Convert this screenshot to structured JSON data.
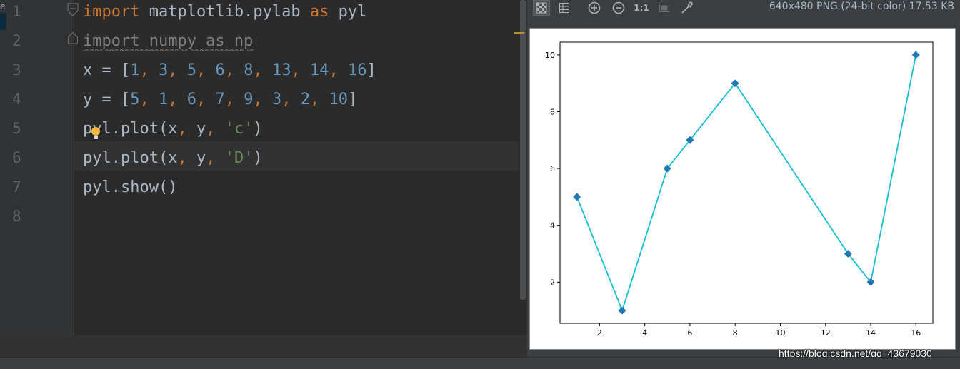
{
  "editor": {
    "side_strip_label": "e",
    "lines": [
      {
        "n": "1",
        "tokens": [
          {
            "t": "import",
            "c": "kw"
          },
          {
            "t": " matplotlib.pylab ",
            "c": ""
          },
          {
            "t": "as",
            "c": "kw"
          },
          {
            "t": " pyl",
            "c": ""
          }
        ]
      },
      {
        "n": "2",
        "tokens": [
          {
            "t": "import numpy as np",
            "c": "gray wavy"
          }
        ]
      },
      {
        "n": "3",
        "tokens": [
          {
            "t": "x = [",
            "c": ""
          },
          {
            "t": "1",
            "c": "num"
          },
          {
            "t": ", ",
            "c": "kw"
          },
          {
            "t": "3",
            "c": "num"
          },
          {
            "t": ", ",
            "c": "kw"
          },
          {
            "t": "5",
            "c": "num"
          },
          {
            "t": ", ",
            "c": "kw"
          },
          {
            "t": "6",
            "c": "num"
          },
          {
            "t": ", ",
            "c": "kw"
          },
          {
            "t": "8",
            "c": "num"
          },
          {
            "t": ", ",
            "c": "kw"
          },
          {
            "t": "13",
            "c": "num"
          },
          {
            "t": ", ",
            "c": "kw"
          },
          {
            "t": "14",
            "c": "num"
          },
          {
            "t": ", ",
            "c": "kw"
          },
          {
            "t": "16",
            "c": "num"
          },
          {
            "t": "]",
            "c": ""
          }
        ]
      },
      {
        "n": "4",
        "tokens": [
          {
            "t": "y = [",
            "c": ""
          },
          {
            "t": "5",
            "c": "num"
          },
          {
            "t": ", ",
            "c": "kw"
          },
          {
            "t": "1",
            "c": "num"
          },
          {
            "t": ", ",
            "c": "kw"
          },
          {
            "t": "6",
            "c": "num"
          },
          {
            "t": ", ",
            "c": "kw"
          },
          {
            "t": "7",
            "c": "num"
          },
          {
            "t": ", ",
            "c": "kw"
          },
          {
            "t": "9",
            "c": "num"
          },
          {
            "t": ", ",
            "c": "kw"
          },
          {
            "t": "3",
            "c": "num"
          },
          {
            "t": ", ",
            "c": "kw"
          },
          {
            "t": "2",
            "c": "num"
          },
          {
            "t": ", ",
            "c": "kw"
          },
          {
            "t": "10",
            "c": "num"
          },
          {
            "t": "]",
            "c": ""
          }
        ]
      },
      {
        "n": "5",
        "tokens": [
          {
            "t": "pyl.plot(x",
            "c": ""
          },
          {
            "t": ", ",
            "c": "kw"
          },
          {
            "t": "y",
            "c": ""
          },
          {
            "t": ", ",
            "c": "kw"
          },
          {
            "t": "'c'",
            "c": "str"
          },
          {
            "t": ")",
            "c": ""
          }
        ]
      },
      {
        "n": "6",
        "tokens": [
          {
            "t": "pyl.plot(x",
            "c": ""
          },
          {
            "t": ", ",
            "c": "kw"
          },
          {
            "t": "y",
            "c": ""
          },
          {
            "t": ", ",
            "c": "kw"
          },
          {
            "t": "'D'",
            "c": "str"
          },
          {
            "t": ")",
            "c": ""
          }
        ]
      },
      {
        "n": "7",
        "tokens": [
          {
            "t": "pyl.show()",
            "c": ""
          }
        ]
      },
      {
        "n": "8",
        "tokens": []
      }
    ]
  },
  "viewer": {
    "toolbar": {
      "chessboard": "chessboard-icon",
      "grid": "grid-icon",
      "zoom_in": "zoom-in-icon",
      "zoom_out": "zoom-out-icon",
      "actual_size_label": "1:1",
      "fit": "fit-to-window-icon",
      "picker": "color-picker-icon"
    },
    "image_info": "640x480 PNG (24-bit color) 17.53 KB"
  },
  "watermark": "https://blog.csdn.net/qq_43679030",
  "colors": {
    "line": "#17becf",
    "marker": "#1f77b4",
    "keyword": "#cc7832",
    "number": "#6897bb",
    "string": "#6a8759"
  },
  "chart_data": {
    "type": "line",
    "x": [
      1,
      3,
      5,
      6,
      8,
      13,
      14,
      16
    ],
    "series": [
      {
        "values": [
          5,
          1,
          6,
          7,
          9,
          3,
          2,
          10
        ],
        "style": "line",
        "color": "#17becf"
      },
      {
        "values": [
          5,
          1,
          6,
          7,
          9,
          3,
          2,
          10
        ],
        "style": "diamond-markers",
        "color": "#1f77b4"
      }
    ],
    "xticks": [
      "2",
      "4",
      "6",
      "8",
      "10",
      "12",
      "14",
      "16"
    ],
    "yticks": [
      "2",
      "4",
      "6",
      "8",
      "10"
    ],
    "xlim": [
      0.25,
      16.75
    ],
    "ylim": [
      0.55,
      10.45
    ],
    "title": "",
    "xlabel": "",
    "ylabel": "",
    "grid": false
  }
}
